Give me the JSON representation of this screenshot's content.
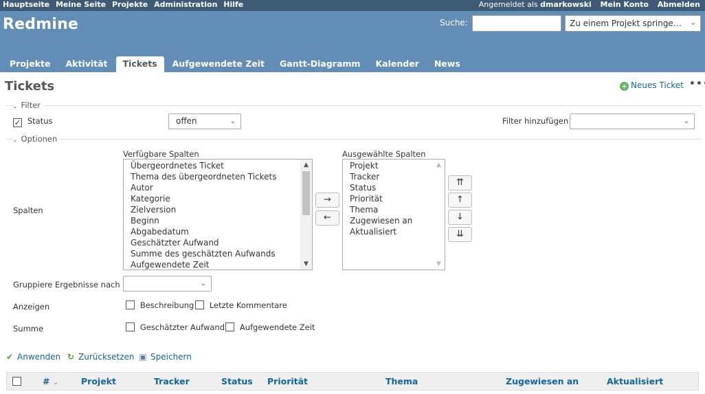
{
  "top_menu": {
    "items": [
      "Hauptseite",
      "Meine Seite",
      "Projekte",
      "Administration",
      "Hilfe"
    ],
    "logged_as_prefix": "Angemeldet als",
    "user": "dmarkowski",
    "my_account": "Mein Konto",
    "logout": "Abmelden"
  },
  "header": {
    "title": "Redmine",
    "search_label": "Suche:",
    "search_value": "",
    "jump_placeholder": "Zu einem Projekt springe…"
  },
  "main_menu": {
    "tabs": [
      {
        "label": "Projekte",
        "selected": false
      },
      {
        "label": "Aktivität",
        "selected": false
      },
      {
        "label": "Tickets",
        "selected": true
      },
      {
        "label": "Aufgewendete Zeit",
        "selected": false
      },
      {
        "label": "Gantt-Diagramm",
        "selected": false
      },
      {
        "label": "Kalender",
        "selected": false
      },
      {
        "label": "News",
        "selected": false
      }
    ]
  },
  "content": {
    "title": "Tickets",
    "new_issue": "Neues Ticket",
    "more": "•••",
    "filter": {
      "legend": "Filter",
      "status_label": "Status",
      "status_checked": true,
      "status_operator": "offen",
      "add_filter_label": "Filter hinzufügen",
      "add_filter_value": ""
    },
    "options": {
      "legend": "Optionen",
      "columns_label": "Spalten",
      "available_label": "Verfügbare Spalten",
      "available": [
        "Übergeordnetes Ticket",
        "Thema des übergeordneten Tickets",
        "Autor",
        "Kategorie",
        "Zielversion",
        "Beginn",
        "Abgabedatum",
        "Geschätzter Aufwand",
        "Summe des geschätzten Aufwands",
        "Aufgewendete Zeit"
      ],
      "selected_label": "Ausgewählte Spalten",
      "selected": [
        "Projekt",
        "Tracker",
        "Status",
        "Priorität",
        "Thema",
        "Zugewiesen an",
        "Aktualisiert"
      ],
      "move_right": "→",
      "move_left": "←",
      "move_top": "⇈",
      "move_up": "↑",
      "move_down": "↓",
      "move_bottom": "⇊",
      "group_label": "Gruppiere Ergebnisse nach",
      "group_value": "",
      "show_label": "Anzeigen",
      "show_description": "Beschreibung",
      "show_last_notes": "Letzte Kommentare",
      "totals_label": "Summe",
      "totals_estimated": "Geschätzter Aufwand",
      "totals_spent": "Aufgewendete Zeit"
    },
    "actions": {
      "apply": "Anwenden",
      "reset": "Zurücksetzen",
      "save": "Speichern"
    },
    "table_headers": {
      "number": "#",
      "project": "Projekt",
      "tracker": "Tracker",
      "status": "Status",
      "priority": "Priorität",
      "subject": "Thema",
      "assigned": "Zugewiesen an",
      "updated": "Aktualisiert"
    }
  },
  "colors": {
    "top_menu_bg": "#3e5b76",
    "header_bg": "#628db6",
    "link": "#116699"
  }
}
